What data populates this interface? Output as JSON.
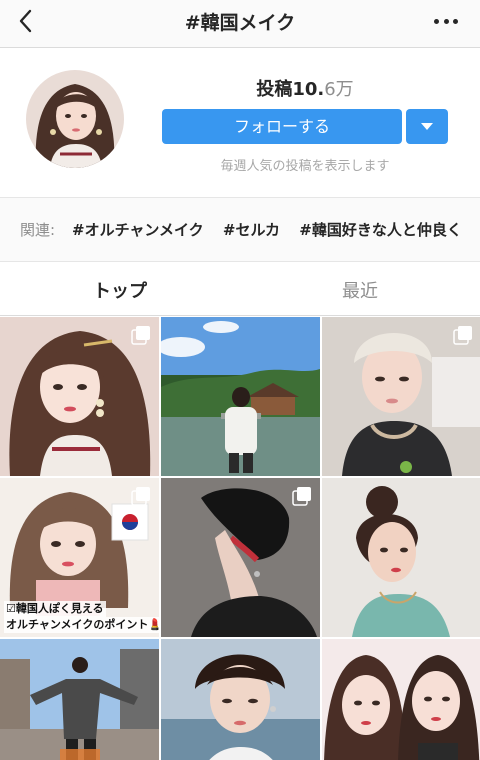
{
  "header": {
    "title": "#韓国メイク"
  },
  "profile": {
    "posts_label": "投稿",
    "posts_main": "10.",
    "posts_dec": "6",
    "posts_unit": "万",
    "follow_label": "フォローする",
    "weekly_text": "毎週人気の投稿を表示します"
  },
  "related": {
    "label": "関連:",
    "tags": [
      "#オルチャンメイク",
      "#セルカ",
      "#韓国好きな人と仲良く"
    ]
  },
  "tabs": {
    "top": "トップ",
    "recent": "最近"
  },
  "grid": {
    "caption_line1": "☑韓国人ぽく見える",
    "caption_line2": "オルチャンメイクのポイント💄"
  },
  "colors": {
    "accent": "#3897f0",
    "text": "#262626",
    "muted": "#8e8e8e"
  }
}
